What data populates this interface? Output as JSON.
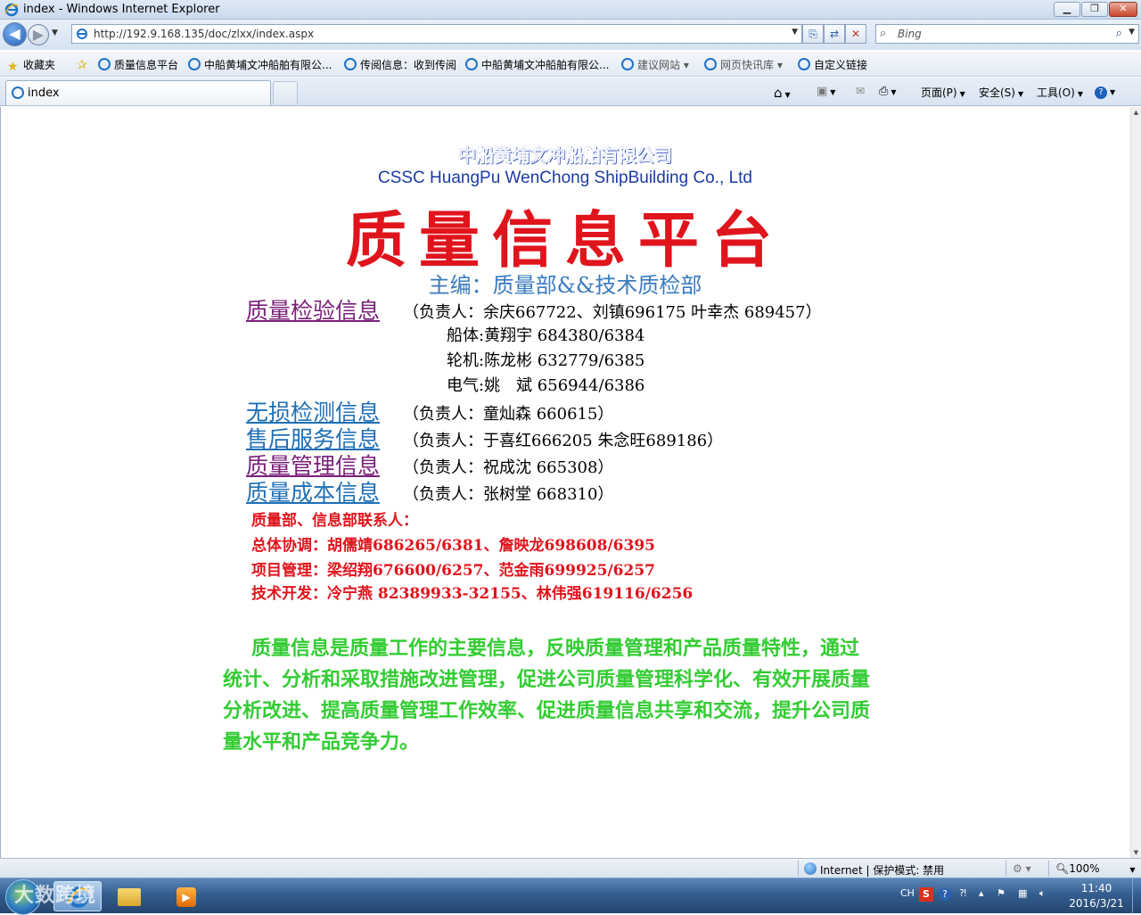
{
  "window": {
    "title": "index - Windows Internet Explorer",
    "min_glyph": "▁",
    "max_glyph": "❐",
    "close_glyph": "✕"
  },
  "nav": {
    "url": "http://192.9.168.135/doc/zlxx/index.aspx",
    "search_placeholder": "Bing"
  },
  "favorites": {
    "label": "收藏夹",
    "items": [
      {
        "label": "质量信息平台",
        "dim": false
      },
      {
        "label": "中船黄埔文冲船舶有限公...",
        "dim": false
      },
      {
        "label": "传阅信息：收到传阅",
        "dim": false
      },
      {
        "label": "中船黄埔文冲船舶有限公...",
        "dim": false
      },
      {
        "label": "建议网站 ▾",
        "dim": true
      },
      {
        "label": "网页快讯库 ▾",
        "dim": true
      },
      {
        "label": "自定义链接",
        "dim": false
      }
    ]
  },
  "tabs": {
    "active_label": "index"
  },
  "commandbar": {
    "page": "页面(P)",
    "safety": "安全(S)",
    "tools": "工具(O)"
  },
  "page": {
    "company_cn": "中船黄埔文冲船舶有限公司",
    "company_en": "CSSC HuangPu WenChong ShipBuilding Co., Ltd",
    "main_title": "质量信息平台",
    "editor": "主编：质量部&&技术质检部",
    "sections": {
      "inspection": {
        "link": "质量检验信息",
        "contact": "（负责人：余庆667722、刘镇696175 叶幸杰 689457）"
      },
      "hull": "船体:黄翔宇 684380/6384",
      "engine": "轮机:陈龙彬 632779/6385",
      "electric": "电气:姚　斌 656944/6386",
      "ndt": {
        "link": "无损检测信息",
        "contact": "（负责人：童灿森 660615）"
      },
      "after_sales": {
        "link": "售后服务信息",
        "contact": "（负责人：于喜红666205 朱念旺689186）"
      },
      "management": {
        "link": "质量管理信息",
        "contact": "（负责人：祝成沈 665308）"
      },
      "cost": {
        "link": "质量成本信息",
        "contact": "（负责人：张树堂 668310）"
      }
    },
    "contacts": {
      "heading": "质量部、信息部联系人：",
      "coord": "总体协调：胡儒靖686265/6381、詹映龙698608/6395",
      "project": "项目管理：梁绍翔676600/6257、范金雨699925/6257",
      "dev": "技术开发：冷宁燕 82389933-32155、林伟强619116/6256"
    },
    "intro": "质量信息是质量工作的主要信息，反映质量管理和产品质量特性，通过统计、分析和采取措施改进管理，促进公司质量管理科学化、有效开展质量分析改进、提高质量管理工作效率、促进质量信息共享和交流，提升公司质量水平和产品竞争力。"
  },
  "status": {
    "zone": "Internet | 保护模式: 禁用",
    "zoom": "100%"
  },
  "taskbar": {
    "lang": "CH",
    "time": "11:40",
    "date": "2016/3/21",
    "watermark": "大数跨境"
  },
  "colors": {
    "title_red": "#e0141c",
    "company_blue": "#1a3cb0",
    "editor_blue": "#3a7bbf",
    "visited_link": "#7a1f7a",
    "link_blue": "#1f6fb5",
    "intro_green": "#33cc33"
  },
  "icons": {
    "ie": "ie-logo-icon",
    "back": "back-arrow-icon",
    "forward": "forward-arrow-icon",
    "search": "magnifier-icon",
    "favorites": "star-icon",
    "home": "home-icon",
    "feeds": "rss-icon",
    "mail": "mail-icon",
    "print": "printer-icon",
    "help": "help-icon"
  }
}
